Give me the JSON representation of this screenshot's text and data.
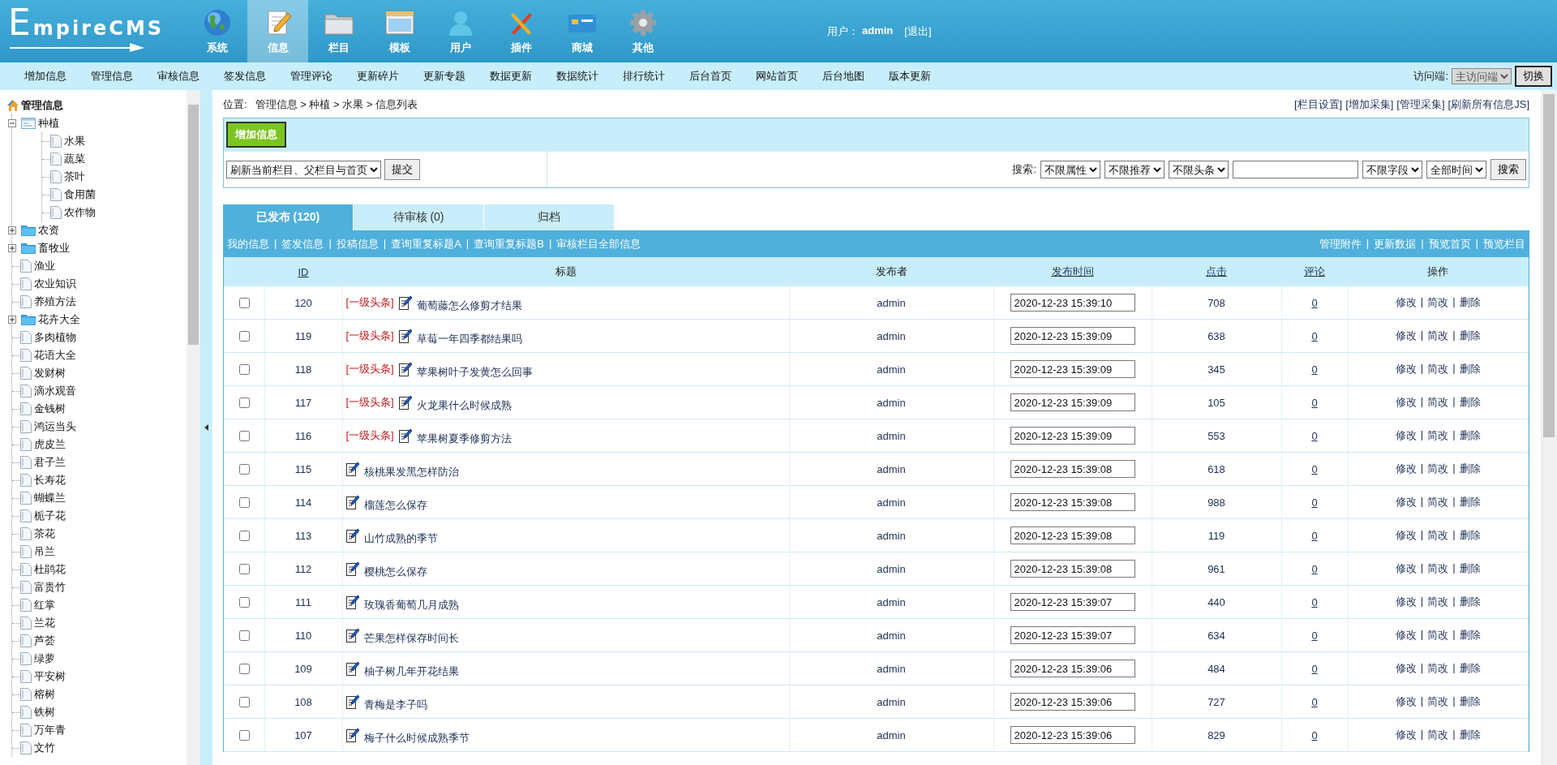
{
  "header": {
    "logo": "EmpireCMS",
    "modules": [
      {
        "label": "系统",
        "selected": false
      },
      {
        "label": "信息",
        "selected": true
      },
      {
        "label": "栏目",
        "selected": false
      },
      {
        "label": "模板",
        "selected": false
      },
      {
        "label": "用户",
        "selected": false
      },
      {
        "label": "插件",
        "selected": false
      },
      {
        "label": "商城",
        "selected": false
      },
      {
        "label": "其他",
        "selected": false
      }
    ],
    "user_label": "用户：",
    "user_name": "admin",
    "logout": "[退出]"
  },
  "nav": {
    "items": [
      "增加信息",
      "管理信息",
      "审核信息",
      "签发信息",
      "管理评论",
      "更新碎片",
      "更新专题",
      "数据更新",
      "数据统计",
      "排行统计",
      "后台首页",
      "网站首页",
      "后台地图",
      "版本更新"
    ],
    "client_label": "访问端:",
    "client_select": "主访问端",
    "switch_button": "切换"
  },
  "sidebar": {
    "root": "管理信息",
    "items": [
      {
        "label": "种植",
        "kind": "column",
        "expanded": true,
        "children": [
          {
            "label": "水果",
            "kind": "page"
          },
          {
            "label": "蔬菜",
            "kind": "page"
          },
          {
            "label": "茶叶",
            "kind": "page"
          },
          {
            "label": "食用菌",
            "kind": "page"
          },
          {
            "label": "农作物",
            "kind": "page"
          }
        ]
      },
      {
        "label": "农资",
        "kind": "folder",
        "expanded": false
      },
      {
        "label": "畜牧业",
        "kind": "folder",
        "expanded": false
      },
      {
        "label": "渔业",
        "kind": "page"
      },
      {
        "label": "农业知识",
        "kind": "page"
      },
      {
        "label": "养殖方法",
        "kind": "page"
      },
      {
        "label": "花卉大全",
        "kind": "folder",
        "expanded": false
      },
      {
        "label": "多肉植物",
        "kind": "page"
      },
      {
        "label": "花语大全",
        "kind": "page"
      },
      {
        "label": "发财树",
        "kind": "page"
      },
      {
        "label": "滴水观音",
        "kind": "page"
      },
      {
        "label": "金钱树",
        "kind": "page"
      },
      {
        "label": "鸿运当头",
        "kind": "page"
      },
      {
        "label": "虎皮兰",
        "kind": "page"
      },
      {
        "label": "君子兰",
        "kind": "page"
      },
      {
        "label": "长寿花",
        "kind": "page"
      },
      {
        "label": "蝴蝶兰",
        "kind": "page"
      },
      {
        "label": "栀子花",
        "kind": "page"
      },
      {
        "label": "茶花",
        "kind": "page"
      },
      {
        "label": "吊兰",
        "kind": "page"
      },
      {
        "label": "杜鹃花",
        "kind": "page"
      },
      {
        "label": "富贵竹",
        "kind": "page"
      },
      {
        "label": "红掌",
        "kind": "page"
      },
      {
        "label": "兰花",
        "kind": "page"
      },
      {
        "label": "芦荟",
        "kind": "page"
      },
      {
        "label": "绿萝",
        "kind": "page"
      },
      {
        "label": "平安树",
        "kind": "page"
      },
      {
        "label": "榕树",
        "kind": "page"
      },
      {
        "label": "铁树",
        "kind": "page"
      },
      {
        "label": "万年青",
        "kind": "page"
      },
      {
        "label": "文竹",
        "kind": "page"
      }
    ]
  },
  "breadcrumb": {
    "label": "位置:",
    "path": "管理信息 > 种植 > 水果 > 信息列表"
  },
  "top_links": [
    "[栏目设置]",
    "[增加采集]",
    "[管理采集]",
    "[刷新所有信息JS]"
  ],
  "add_button": "增加信息",
  "refresh": {
    "select": "刷新当前栏目、父栏目与首页",
    "button": "提交"
  },
  "search": {
    "label": "搜索:",
    "filters": [
      "不限属性",
      "不限推荐",
      "不限头条"
    ],
    "scopes": [
      "不限字段",
      "全部时间"
    ],
    "button": "搜索"
  },
  "tabs": [
    {
      "label": "已发布 (120)",
      "selected": true
    },
    {
      "label": "待审核 (0)",
      "selected": false
    },
    {
      "label": "归档",
      "selected": false
    }
  ],
  "table": {
    "separator": "|",
    "left_links": [
      "我的信息",
      "签发信息",
      "投稿信息",
      "查询重复标题A",
      "查询重复标题B",
      "审核栏目全部信息"
    ],
    "right_links": [
      "管理附件",
      "更新数据",
      "预览首页",
      "预览栏目"
    ],
    "columns": [
      {
        "label": "ID",
        "sortable": true
      },
      {
        "label": "标题",
        "sortable": false
      },
      {
        "label": "发布者",
        "sortable": false
      },
      {
        "label": "发布时间",
        "sortable": true
      },
      {
        "label": "点击",
        "sortable": true
      },
      {
        "label": "评论",
        "sortable": true
      },
      {
        "label": "操作",
        "sortable": false
      }
    ],
    "rows": [
      {
        "checked": false,
        "id": "120",
        "tag": "[一级头条]",
        "title": "葡萄藤怎么修剪才结果",
        "author": "admin",
        "time": "2020-12-23 15:39:10",
        "clicks": "708",
        "comments": "0",
        "actions": [
          "修改",
          "简改",
          "删除"
        ]
      },
      {
        "checked": false,
        "id": "119",
        "tag": "[一级头条]",
        "title": "草莓一年四季都结果吗",
        "author": "admin",
        "time": "2020-12-23 15:39:09",
        "clicks": "638",
        "comments": "0",
        "actions": [
          "修改",
          "简改",
          "删除"
        ]
      },
      {
        "checked": false,
        "id": "118",
        "tag": "[一级头条]",
        "title": "苹果树叶子发黄怎么回事",
        "author": "admin",
        "time": "2020-12-23 15:39:09",
        "clicks": "345",
        "comments": "0",
        "actions": [
          "修改",
          "简改",
          "删除"
        ]
      },
      {
        "checked": false,
        "id": "117",
        "tag": "[一级头条]",
        "title": "火龙果什么时候成熟",
        "author": "admin",
        "time": "2020-12-23 15:39:09",
        "clicks": "105",
        "comments": "0",
        "actions": [
          "修改",
          "简改",
          "删除"
        ]
      },
      {
        "checked": false,
        "id": "116",
        "tag": "[一级头条]",
        "title": "苹果树夏季修剪方法",
        "author": "admin",
        "time": "2020-12-23 15:39:09",
        "clicks": "553",
        "comments": "0",
        "actions": [
          "修改",
          "简改",
          "删除"
        ]
      },
      {
        "checked": false,
        "id": "115",
        "title": "核桃果发黑怎样防治",
        "author": "admin",
        "time": "2020-12-23 15:39:08",
        "clicks": "618",
        "comments": "0",
        "actions": [
          "修改",
          "简改",
          "删除"
        ]
      },
      {
        "checked": false,
        "id": "114",
        "title": "榴莲怎么保存",
        "author": "admin",
        "time": "2020-12-23 15:39:08",
        "clicks": "988",
        "comments": "0",
        "actions": [
          "修改",
          "简改",
          "删除"
        ]
      },
      {
        "checked": false,
        "id": "113",
        "title": "山竹成熟的季节",
        "author": "admin",
        "time": "2020-12-23 15:39:08",
        "clicks": "119",
        "comments": "0",
        "actions": [
          "修改",
          "简改",
          "删除"
        ]
      },
      {
        "checked": false,
        "id": "112",
        "title": "樱桃怎么保存",
        "author": "admin",
        "time": "2020-12-23 15:39:08",
        "clicks": "961",
        "comments": "0",
        "actions": [
          "修改",
          "简改",
          "删除"
        ]
      },
      {
        "checked": false,
        "id": "111",
        "title": "玫瑰香葡萄几月成熟",
        "author": "admin",
        "time": "2020-12-23 15:39:07",
        "clicks": "440",
        "comments": "0",
        "actions": [
          "修改",
          "简改",
          "删除"
        ]
      },
      {
        "checked": false,
        "id": "110",
        "title": "芒果怎样保存时间长",
        "author": "admin",
        "time": "2020-12-23 15:39:07",
        "clicks": "634",
        "comments": "0",
        "actions": [
          "修改",
          "简改",
          "删除"
        ]
      },
      {
        "checked": false,
        "id": "109",
        "title": "柚子树几年开花结果",
        "author": "admin",
        "time": "2020-12-23 15:39:06",
        "clicks": "484",
        "comments": "0",
        "actions": [
          "修改",
          "简改",
          "删除"
        ]
      },
      {
        "checked": false,
        "id": "108",
        "title": "青梅是李子吗",
        "author": "admin",
        "time": "2020-12-23 15:39:06",
        "clicks": "727",
        "comments": "0",
        "actions": [
          "修改",
          "简改",
          "删除"
        ]
      },
      {
        "checked": false,
        "id": "107",
        "title": "梅子什么时候成熟季节",
        "author": "admin",
        "time": "2020-12-23 15:39:06",
        "clicks": "829",
        "comments": "0",
        "actions": [
          "修改",
          "简改",
          "删除"
        ]
      }
    ]
  }
}
